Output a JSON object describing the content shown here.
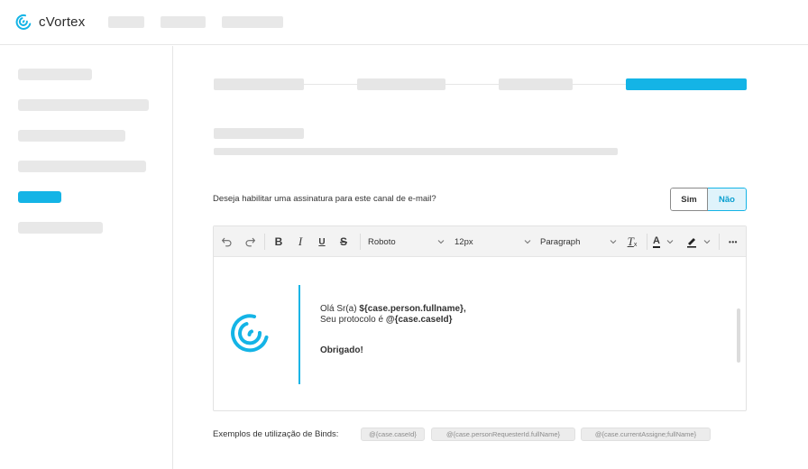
{
  "app": {
    "brand": "cVortex",
    "brand_color": "#14b4e6"
  },
  "form": {
    "question": "Deseja habilitar uma assinatura para este canal de e-mail?",
    "options": [
      {
        "label": "Sim",
        "selected": false
      },
      {
        "label": "Não",
        "selected": true
      }
    ]
  },
  "editor": {
    "toolbar": {
      "undo_icon": "undo-icon",
      "redo_icon": "redo-icon",
      "bold": "B",
      "italic": "I",
      "underline": "U",
      "strike": "S",
      "font_family": "Roboto",
      "font_size": "12px",
      "block_format": "Paragraph",
      "clear_format": "T",
      "text_color": "A",
      "more": "•••"
    },
    "signature": {
      "greeting_prefix": "Olá Sr(a)",
      "greeting_bind": "${case.person.fullname},",
      "protocol_prefix": "Seu protocolo é",
      "protocol_bind": "@{case.caseId}",
      "closing": "Obrigado!"
    }
  },
  "binds": {
    "label": "Exemplos de utilização de Binds:",
    "examples": [
      "@{case.caseId}",
      "@{case.personRequesterId.fullName}",
      "@{case.currentAssigne;fullName}"
    ]
  }
}
